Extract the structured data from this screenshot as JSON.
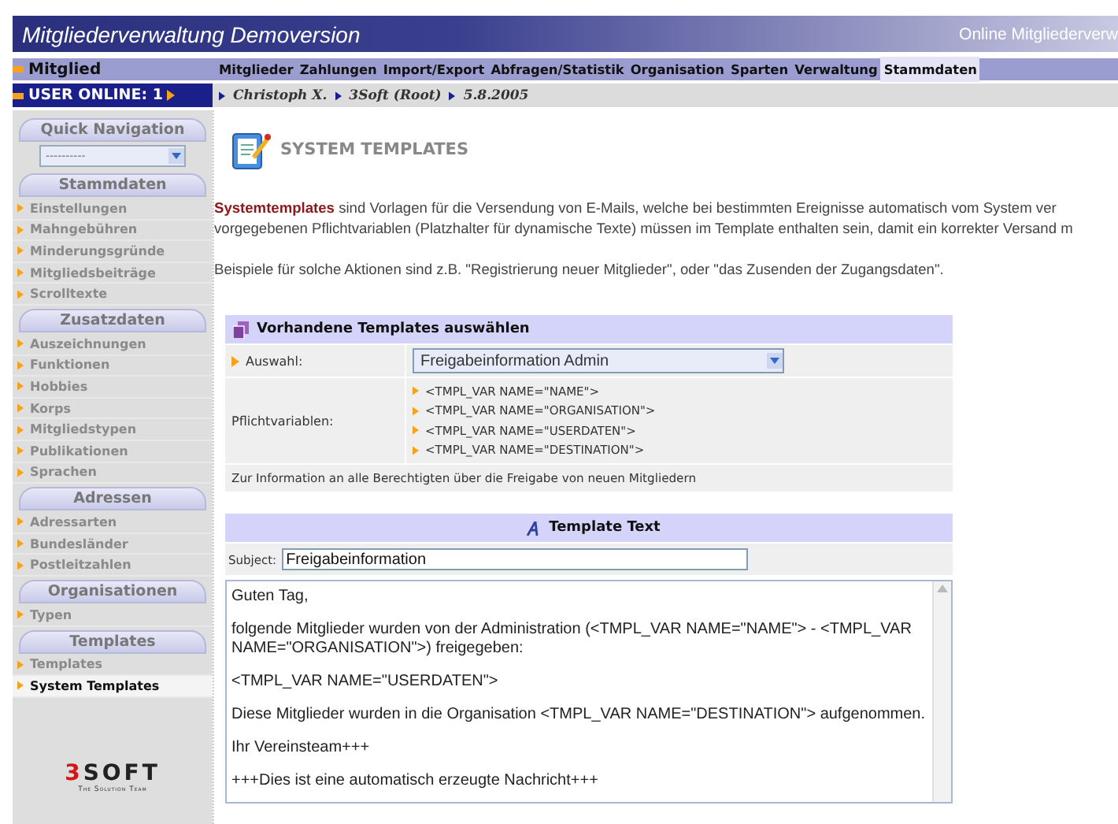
{
  "header": {
    "title": "Mitgliederverwaltung Demoversion",
    "subtitle": "Online Mitgliederverw"
  },
  "member_label": "Mitglied",
  "user_online": "USER ONLINE: 1",
  "menu": [
    {
      "label": "Mitglieder",
      "selected": false
    },
    {
      "label": "Zahlungen",
      "selected": false
    },
    {
      "label": "Import/Export",
      "selected": false
    },
    {
      "label": "Abfragen/Statistik",
      "selected": false
    },
    {
      "label": "Organisation",
      "selected": false
    },
    {
      "label": "Sparten",
      "selected": false
    },
    {
      "label": "Verwaltung",
      "selected": false
    },
    {
      "label": "Stammdaten",
      "selected": true
    }
  ],
  "breadcrumb": [
    "Christoph X.",
    "3Soft (Root)",
    "5.8.2005"
  ],
  "quick_navigation": {
    "title": "Quick Navigation",
    "value": "----------"
  },
  "sidebar": [
    {
      "title": "Stammdaten",
      "items": [
        {
          "label": "Einstellungen",
          "selected": false
        },
        {
          "label": "Mahngebühren",
          "selected": false
        },
        {
          "label": "Minderungsgründe",
          "selected": false
        },
        {
          "label": "Mitgliedsbeiträge",
          "selected": false
        },
        {
          "label": "Scrolltexte",
          "selected": false
        }
      ]
    },
    {
      "title": "Zusatzdaten",
      "items": [
        {
          "label": "Auszeichnungen",
          "selected": false
        },
        {
          "label": "Funktionen",
          "selected": false
        },
        {
          "label": "Hobbies",
          "selected": false
        },
        {
          "label": "Korps",
          "selected": false
        },
        {
          "label": "Mitgliedstypen",
          "selected": false
        },
        {
          "label": "Publikationen",
          "selected": false
        },
        {
          "label": "Sprachen",
          "selected": false
        }
      ]
    },
    {
      "title": "Adressen",
      "items": [
        {
          "label": "Adressarten",
          "selected": false
        },
        {
          "label": "Bundesländer",
          "selected": false
        },
        {
          "label": "Postleitzahlen",
          "selected": false
        }
      ]
    },
    {
      "title": "Organisationen",
      "items": [
        {
          "label": "Typen",
          "selected": false
        }
      ]
    },
    {
      "title": "Templates",
      "items": [
        {
          "label": "Templates",
          "selected": false
        },
        {
          "label": "System Templates",
          "selected": true
        }
      ]
    }
  ],
  "logo": {
    "text": "3SOFT",
    "tagline": "The Solution Team"
  },
  "page": {
    "title": "SYSTEM TEMPLATES",
    "intro_lines": [
      "**Systemtemplates** sind Vorlagen für die Versendung von E-Mails, welche bei bestimmten Ereignisse automatisch vom System ver",
      "vorgegebenen Pflichtvariablen (Platzhalter für dynamische Texte) müssen im Template enthalten sein, damit ein korrekter Versand m"
    ],
    "example": "Beispiele für solche Aktionen sind z.B. \"Registrierung neuer Mitglieder\", oder \"das Zusenden der Zugangsdaten\"."
  },
  "templates_panel": {
    "title": "Vorhandene Templates auswählen",
    "selection_label": "Auswahl:",
    "selection_value": "Freigabeinformation Admin",
    "variables_label": "Pflichtvariablen:",
    "variables": [
      "<TMPL_VAR NAME=\"NAME\">",
      "<TMPL_VAR NAME=\"ORGANISATION\">",
      "<TMPL_VAR NAME=\"USERDATEN\">",
      "<TMPL_VAR NAME=\"DESTINATION\">"
    ],
    "note": "Zur Information an alle Berechtigten über die Freigabe von neuen Mitgliedern"
  },
  "template_text": {
    "title": "Template Text",
    "subject_label": "Subject:",
    "subject_value": "Freigabeinformation",
    "body_paragraphs": [
      "Guten Tag,",
      "folgende Mitglieder wurden von der Administration (<TMPL_VAR NAME=\"NAME\"> - <TMPL_VAR NAME=\"ORGANISATION\">) freigegeben:",
      "<TMPL_VAR NAME=\"USERDATEN\">",
      "Diese Mitglieder wurden in die Organisation <TMPL_VAR NAME=\"DESTINATION\"> aufgenommen.",
      "Ihr Vereinsteam+++",
      "+++Dies ist eine automatisch erzeugte Nachricht+++"
    ]
  }
}
